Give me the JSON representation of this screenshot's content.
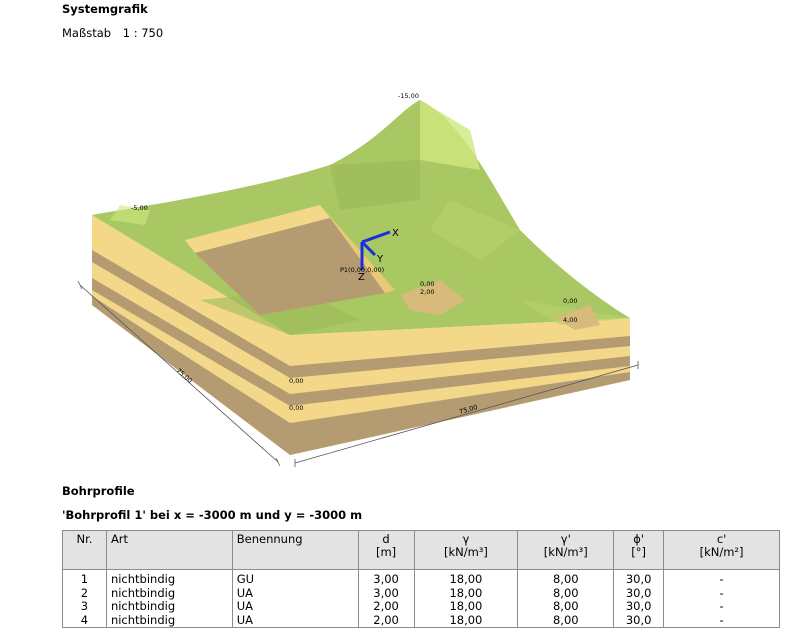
{
  "header": {
    "title": "Systemgrafik",
    "scale_label": "Maßstab",
    "scale_value": "1 : 750"
  },
  "graphic": {
    "labels": {
      "peak": "-15,00",
      "left_top": "-5,00",
      "point": "P1(0,00,0,00)",
      "axis_x": "X",
      "axis_y": "Y",
      "axis_z": "Z",
      "center_a": "0,00",
      "center_b": "2,00",
      "right_a": "0,00",
      "right_b": "4,00",
      "left_a": "0,00",
      "left_b": "0,00",
      "dim_left": "75,00",
      "dim_front": "75,00"
    },
    "colors": {
      "terrain": "#a9c763",
      "terrain_light": "#cfe77e",
      "sand": "#f2d888",
      "brown": "#b49b72",
      "axis": "#1a2ee0"
    }
  },
  "profiles": {
    "title": "Bohrprofile",
    "subtitle": "'Bohrprofil 1' bei x = -3000 m und y = -3000 m",
    "columns": [
      {
        "label": "Nr.",
        "unit": ""
      },
      {
        "label": "Art",
        "unit": ""
      },
      {
        "label": "Benennung",
        "unit": ""
      },
      {
        "label": "d",
        "unit": "[m]"
      },
      {
        "label": "γ",
        "unit": "[kN/m³]"
      },
      {
        "label": "γ'",
        "unit": "[kN/m³]"
      },
      {
        "label": "ϕ'",
        "unit": "[°]"
      },
      {
        "label": "c'",
        "unit": "[kN/m²]"
      }
    ],
    "rows": [
      [
        "1",
        "nichtbindig",
        "GU",
        "3,00",
        "18,00",
        "8,00",
        "30,0",
        "-"
      ],
      [
        "2",
        "nichtbindig",
        "UA",
        "3,00",
        "18,00",
        "8,00",
        "30,0",
        "-"
      ],
      [
        "3",
        "nichtbindig",
        "UA",
        "2,00",
        "18,00",
        "8,00",
        "30,0",
        "-"
      ],
      [
        "4",
        "nichtbindig",
        "UA",
        "2,00",
        "18,00",
        "8,00",
        "30,0",
        "-"
      ]
    ]
  }
}
